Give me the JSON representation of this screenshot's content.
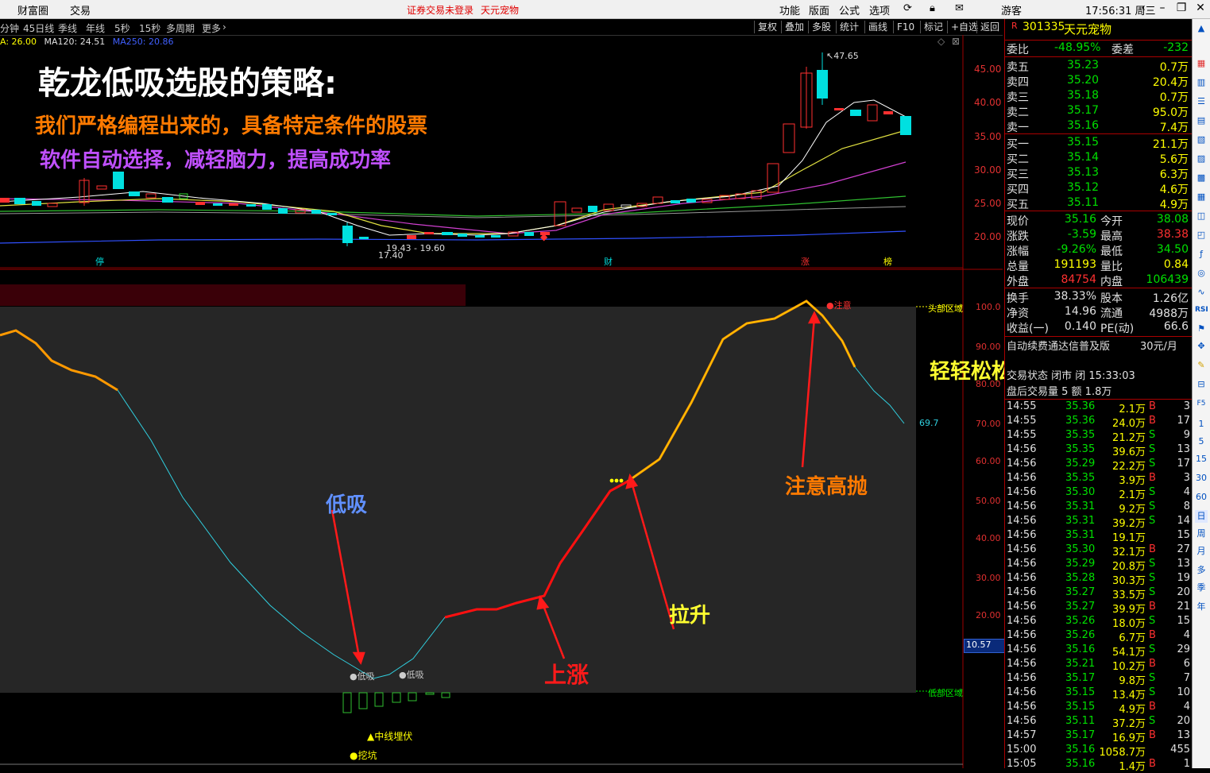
{
  "menubar": {
    "left": [
      "财富圈",
      "交易"
    ],
    "notice": "证券交易未登录",
    "stock_link": "天元宠物",
    "right": [
      "功能",
      "版面",
      "公式",
      "选项"
    ],
    "user": "游客",
    "clock": "17:56:31 周三"
  },
  "toolbar": {
    "periods": [
      "分钟",
      "45日线",
      "季线",
      "年线",
      "5秒",
      "15秒",
      "多周期",
      "更多"
    ],
    "right_buttons": [
      "复权",
      "叠加",
      "多股",
      "统计",
      "画线",
      "F10",
      "标记",
      "+自选",
      "返回"
    ]
  },
  "ma_line": {
    "ma_prev": "A: 26.00",
    "ma120": "MA120: 24.51",
    "ma250": "MA250: 20.86"
  },
  "price_axis": [
    "45.00",
    "40.00",
    "35.00",
    "30.00",
    "25.00",
    "20.00"
  ],
  "candle_annotations": {
    "high": "47.65",
    "low_range": "19.43 - 19.60",
    "low": "17.40"
  },
  "event_markers": [
    "停",
    "财",
    "涨",
    "榜"
  ],
  "overlay_text": {
    "title": "乾龙低吸选股的策略:",
    "line1": "我们严格编程出来的，具备特定条件的股票",
    "line2": "软件自动选择，减轻脑力，提高成功率",
    "easy": "轻轻松松吃上一波！！！",
    "dixi": "低吸",
    "shangzhang": "上涨",
    "lasheng": "拉升",
    "gaopao": "注意高抛"
  },
  "indicator": {
    "axis": [
      "100.0",
      "90.00",
      "80.00",
      "70.00",
      "60.00",
      "50.00",
      "40.00",
      "30.00",
      "20.00"
    ],
    "top_zone": "头部区域",
    "bottom_zone": "低部区域",
    "current_value": "69.7",
    "box_value": "10.57",
    "notice_marker": "●注意",
    "dixi_mark1": "●低吸",
    "dixi_mark2": "●低吸",
    "zhongxian": "▲中线埋伏",
    "wakeng": "●挖坑"
  },
  "quote": {
    "code": "301335",
    "name": "天元宠物",
    "weibi_label": "委比",
    "weibi": "-48.95%",
    "weicha_label": "委差",
    "weicha": "-232",
    "asks": [
      {
        "label": "卖五",
        "price": "35.23",
        "vol": "0.7万"
      },
      {
        "label": "卖四",
        "price": "35.20",
        "vol": "20.4万"
      },
      {
        "label": "卖三",
        "price": "35.18",
        "vol": "0.7万"
      },
      {
        "label": "卖二",
        "price": "35.17",
        "vol": "95.0万"
      },
      {
        "label": "卖一",
        "price": "35.16",
        "vol": "7.4万"
      }
    ],
    "bids": [
      {
        "label": "买一",
        "price": "35.15",
        "vol": "21.1万"
      },
      {
        "label": "买二",
        "price": "35.14",
        "vol": "5.6万"
      },
      {
        "label": "买三",
        "price": "35.13",
        "vol": "6.3万"
      },
      {
        "label": "买四",
        "price": "35.12",
        "vol": "4.6万"
      },
      {
        "label": "买五",
        "price": "35.11",
        "vol": "4.9万"
      }
    ],
    "stats": [
      {
        "l1": "现价",
        "v1": "35.16",
        "l2": "今开",
        "v2": "38.08"
      },
      {
        "l1": "涨跌",
        "v1": "-3.59",
        "l2": "最高",
        "v2": "38.38"
      },
      {
        "l1": "涨幅",
        "v1": "-9.26%",
        "l2": "最低",
        "v2": "34.50"
      },
      {
        "l1": "总量",
        "v1": "191193",
        "l2": "量比",
        "v2": "0.84"
      },
      {
        "l1": "外盘",
        "v1": "84754",
        "l2": "内盘",
        "v2": "106439"
      }
    ],
    "stats2": [
      {
        "l1": "换手",
        "v1": "38.33%",
        "l2": "股本",
        "v2": "1.26亿"
      },
      {
        "l1": "净资",
        "v1": "14.96",
        "l2": "流通",
        "v2": "4988万"
      },
      {
        "l1": "收益(一)",
        "v1": "0.140",
        "l2": "PE(动)",
        "v2": "66.6"
      }
    ],
    "promo": "自动续费通达信普及版",
    "promo_price": "30元/月",
    "after_close": "交易状态 闭市 闭 15:33:03",
    "after_vol": "盘后交易量 5 额 1.8万"
  },
  "ticks": [
    [
      "14:55",
      "35.36",
      "2.1万",
      "B",
      "3"
    ],
    [
      "14:55",
      "35.36",
      "24.0万",
      "B",
      "17"
    ],
    [
      "14:55",
      "35.35",
      "21.2万",
      "S",
      "9"
    ],
    [
      "14:56",
      "35.35",
      "39.6万",
      "S",
      "13"
    ],
    [
      "14:56",
      "35.29",
      "22.2万",
      "S",
      "17"
    ],
    [
      "14:56",
      "35.35",
      "3.9万",
      "B",
      "3"
    ],
    [
      "14:56",
      "35.30",
      "2.1万",
      "S",
      "4"
    ],
    [
      "14:56",
      "35.31",
      "9.2万",
      "S",
      "8"
    ],
    [
      "14:56",
      "35.31",
      "39.2万",
      "S",
      "14"
    ],
    [
      "14:56",
      "35.31",
      "19.1万",
      "",
      "15"
    ],
    [
      "14:56",
      "35.30",
      "32.1万",
      "B",
      "27"
    ],
    [
      "14:56",
      "35.29",
      "20.8万",
      "S",
      "13"
    ],
    [
      "14:56",
      "35.28",
      "30.3万",
      "S",
      "19"
    ],
    [
      "14:56",
      "35.27",
      "33.5万",
      "S",
      "20"
    ],
    [
      "14:56",
      "35.27",
      "39.9万",
      "B",
      "21"
    ],
    [
      "14:56",
      "35.26",
      "18.0万",
      "S",
      "15"
    ],
    [
      "14:56",
      "35.26",
      "6.7万",
      "B",
      "4"
    ],
    [
      "14:56",
      "35.16",
      "54.1万",
      "S",
      "29"
    ],
    [
      "14:56",
      "35.21",
      "10.2万",
      "B",
      "6"
    ],
    [
      "14:56",
      "35.17",
      "9.8万",
      "S",
      "7"
    ],
    [
      "14:56",
      "35.15",
      "13.4万",
      "S",
      "10"
    ],
    [
      "14:56",
      "35.15",
      "4.9万",
      "B",
      "4"
    ],
    [
      "14:56",
      "35.11",
      "37.2万",
      "S",
      "20"
    ],
    [
      "14:57",
      "35.17",
      "16.9万",
      "B",
      "13"
    ],
    [
      "15:00",
      "35.16",
      "1058.7万",
      "",
      "455"
    ],
    [
      "15:05",
      "35.16",
      "1.4万",
      "B",
      "1"
    ]
  ],
  "vstrip": [
    "RSI",
    "F5",
    "1",
    "5",
    "15",
    "30",
    "60",
    "日",
    "周",
    "月",
    "多",
    "季",
    "年"
  ],
  "colors": {
    "up": "#ff3030",
    "down": "#00e0e0",
    "accent_red": "#e00000"
  }
}
